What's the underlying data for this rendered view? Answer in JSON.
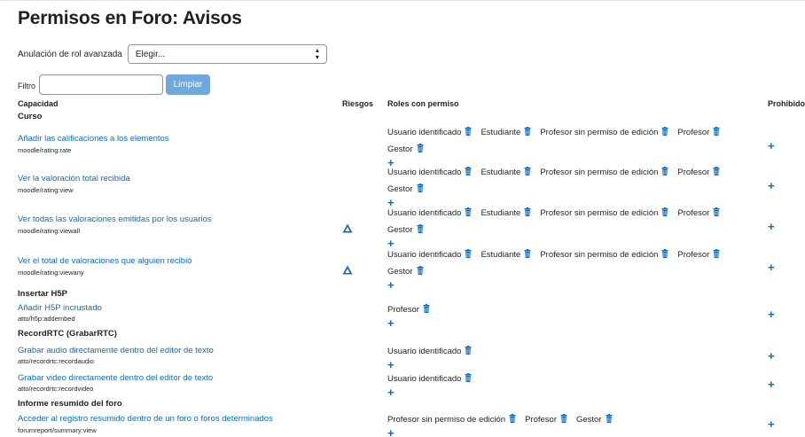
{
  "page": {
    "title": "Permisos en Foro: Avisos"
  },
  "override": {
    "label": "Anulación de rol avanzada",
    "selected": "Elegir..."
  },
  "filter": {
    "label": "Filtro",
    "value": "",
    "clear_label": "Limpiar"
  },
  "table": {
    "headers": {
      "capability": "Capacidad",
      "risks": "Riesgos",
      "roles": "Roles con permiso",
      "prohibited": "Prohibido"
    }
  },
  "sections": [
    {
      "title": "Curso"
    },
    {
      "title": "Insertar H5P"
    },
    {
      "title": "RecordRTC (GrabarRTC)"
    },
    {
      "title": "Informe resumido del foro"
    }
  ],
  "rows": [
    {
      "name": "Añadir las calificaciones a los elementos",
      "code": "moodle/rating:rate",
      "risk": false,
      "roles": [
        "Usuario identificado",
        "Estudiante",
        "Profesor sin permiso de edición",
        "Profesor",
        "Gestor"
      ]
    },
    {
      "name": "Ver la valoración total recibida",
      "code": "moodle/rating:view",
      "risk": false,
      "roles": [
        "Usuario identificado",
        "Estudiante",
        "Profesor sin permiso de edición",
        "Profesor",
        "Gestor"
      ]
    },
    {
      "name": "Ver todas las valoraciones emitidas por los usuarios",
      "code": "moodle/rating:viewall",
      "risk": true,
      "roles": [
        "Usuario identificado",
        "Estudiante",
        "Profesor sin permiso de edición",
        "Profesor",
        "Gestor"
      ]
    },
    {
      "name": "Ver el total de valoraciones que alguien recibió",
      "code": "moodle/rating:viewany",
      "risk": true,
      "roles": [
        "Usuario identificado",
        "Estudiante",
        "Profesor sin permiso de edición",
        "Profesor",
        "Gestor"
      ]
    },
    {
      "name": "Añadir H5P incrustado",
      "code": "atto/h5p:addembed",
      "risk": false,
      "roles": [
        "Profesor"
      ]
    },
    {
      "name": "Grabar audio directamente dentro del editor de texto",
      "code": "atto/recordrtc:recordaudio",
      "risk": false,
      "roles": [
        "Usuario identificado"
      ]
    },
    {
      "name": "Grabar video directamente dentro del editor de texto",
      "code": "atto/recordrtc:recordvideo",
      "risk": false,
      "roles": [
        "Usuario identificado"
      ]
    },
    {
      "name": "Acceder al registro resumido dentro de un foro o foros determinados",
      "code": "forumreport/summary:view",
      "risk": false,
      "roles": [
        "Profesor sin permiso de edición",
        "Profesor",
        "Gestor"
      ]
    }
  ],
  "icons": {
    "delete": "trash-icon",
    "add": "plus-icon",
    "risk": "warning-icon",
    "select": "updown-arrows-icon"
  },
  "colors": {
    "link": "#0f6cbf",
    "button": "#6fa8dc",
    "risk": "#1d62b6"
  }
}
